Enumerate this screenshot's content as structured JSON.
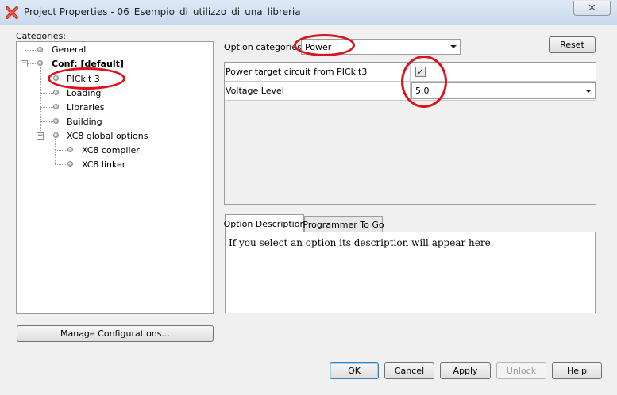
{
  "window": {
    "title": "Project Properties - 06_Esempio_di_utilizzo_di_una_libreria",
    "close_glyph": "✕",
    "app_icon": "red-x-app-icon"
  },
  "categories": {
    "label": "Categories:",
    "tree": [
      {
        "label": "General"
      },
      {
        "label": "Conf: [default]"
      },
      {
        "label": "PICkit 3"
      },
      {
        "label": "Loading"
      },
      {
        "label": "Libraries"
      },
      {
        "label": "Building"
      },
      {
        "label": "XC8 global options"
      },
      {
        "label": "XC8 compiler"
      },
      {
        "label": "XC8 linker"
      }
    ],
    "manage_button": "Manage Configurations..."
  },
  "options": {
    "categories_label": "Option categories:",
    "selected_category": "Power",
    "reset_button": "Reset",
    "properties": [
      {
        "name": "Power target circuit from PICkit3",
        "checked": true
      },
      {
        "name": "Voltage Level",
        "value": "5.0"
      }
    ],
    "check_glyph": "✓"
  },
  "tabs": [
    {
      "label": "Option Description",
      "active": true
    },
    {
      "label": "Programmer To Go",
      "active": false
    }
  ],
  "description": "If you select an option its description will appear here.",
  "buttons": {
    "ok": "OK",
    "cancel": "Cancel",
    "apply": "Apply",
    "unlock": "Unlock",
    "help": "Help"
  },
  "colors": {
    "annotation": "#d9141c",
    "default_button_border": "#3c7fb1"
  }
}
